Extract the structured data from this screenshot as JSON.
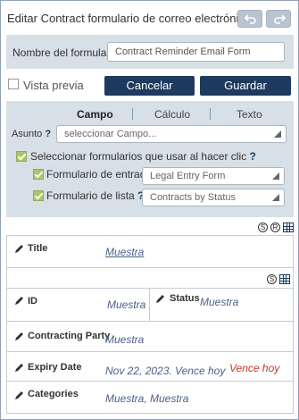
{
  "window": {
    "title": "Editar Contract formulario de correo electrónico"
  },
  "form_name": {
    "label": "Nombre del formulario",
    "value": "Contract Reminder Email Form"
  },
  "actions": {
    "preview_label": "Vista previa",
    "preview_checked": false,
    "cancel_label": "Cancelar",
    "save_label": "Guardar"
  },
  "config": {
    "tabs": [
      {
        "label": "Campo",
        "active": true
      },
      {
        "label": "Cálculo",
        "active": false
      },
      {
        "label": "Texto",
        "active": false
      }
    ],
    "asunto": {
      "label": "Asunto",
      "help": "?",
      "placeholder": "seleccionar Campo..."
    },
    "select_forms": {
      "label": "Seleccionar formularios que usar al hacer clic",
      "help": "?",
      "checked": true
    },
    "entry_form": {
      "label": "Formulario de entrada",
      "help": "?",
      "checked": true,
      "value": "Legal Entry Form"
    },
    "list_form": {
      "label": "Formulario de lista",
      "help": "?",
      "checked": true,
      "value": "Contracts by Status"
    }
  },
  "toolbar_icons": {
    "top": [
      "s-icon",
      "r-icon",
      "grid-icon"
    ],
    "inner": [
      "s-icon",
      "grid-icon"
    ],
    "s_glyph": "S",
    "r_glyph": "R"
  },
  "fields": {
    "title": {
      "label": "Title",
      "value": "Muestra"
    },
    "id": {
      "label": "ID",
      "value": "Muestra"
    },
    "status": {
      "label": "Status",
      "value": "Muestra"
    },
    "contracting_party": {
      "label": "Contracting Party",
      "value": "Muestra"
    },
    "expiry_date": {
      "label": "Expiry Date",
      "value": "Nov 22, 2023. Vence hoy",
      "badge": "Vence hoy"
    },
    "categories": {
      "label": "Categories",
      "value": "Muestra, Muestra"
    }
  },
  "colors": {
    "navy": "#1e3a5f",
    "panel": "#d7dfe7",
    "checkbox_green": "#a6c86a",
    "link": "#4a5f8a",
    "alert_red": "#c0392b"
  }
}
